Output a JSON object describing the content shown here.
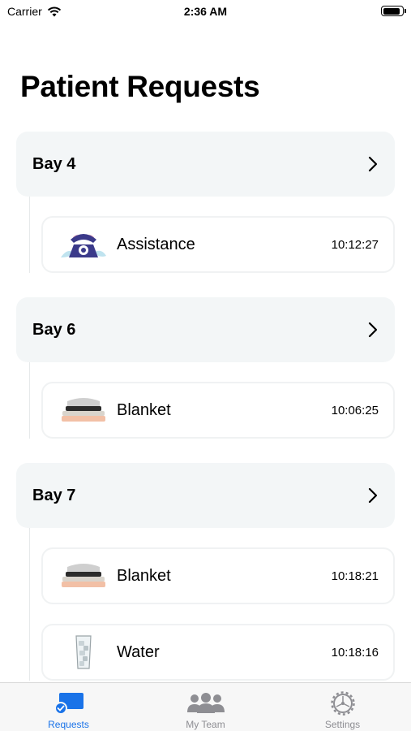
{
  "status_bar": {
    "carrier": "Carrier",
    "time": "2:36 AM",
    "battery_level": 0.95
  },
  "page": {
    "title": "Patient Requests"
  },
  "bays": [
    {
      "label": "Bay 4",
      "requests": [
        {
          "item": "Assistance",
          "time": "10:12:27",
          "icon": "telephone-icon"
        }
      ]
    },
    {
      "label": "Bay 6",
      "requests": [
        {
          "item": "Blanket",
          "time": "10:06:25",
          "icon": "blanket-icon"
        }
      ]
    },
    {
      "label": "Bay 7",
      "requests": [
        {
          "item": "Blanket",
          "time": "10:18:21",
          "icon": "blanket-icon"
        },
        {
          "item": "Water",
          "time": "10:18:16",
          "icon": "water-glass-icon"
        }
      ]
    }
  ],
  "tabs": [
    {
      "label": "Requests",
      "icon": "requests-icon",
      "active": true
    },
    {
      "label": "My Team",
      "icon": "team-icon",
      "active": false
    },
    {
      "label": "Settings",
      "icon": "settings-gear-icon",
      "active": false
    }
  ],
  "colors": {
    "accent": "#1a73e8",
    "header_bg": "#f3f6f7",
    "inactive": "#8e8e93",
    "phone": "#3b3a8a"
  }
}
